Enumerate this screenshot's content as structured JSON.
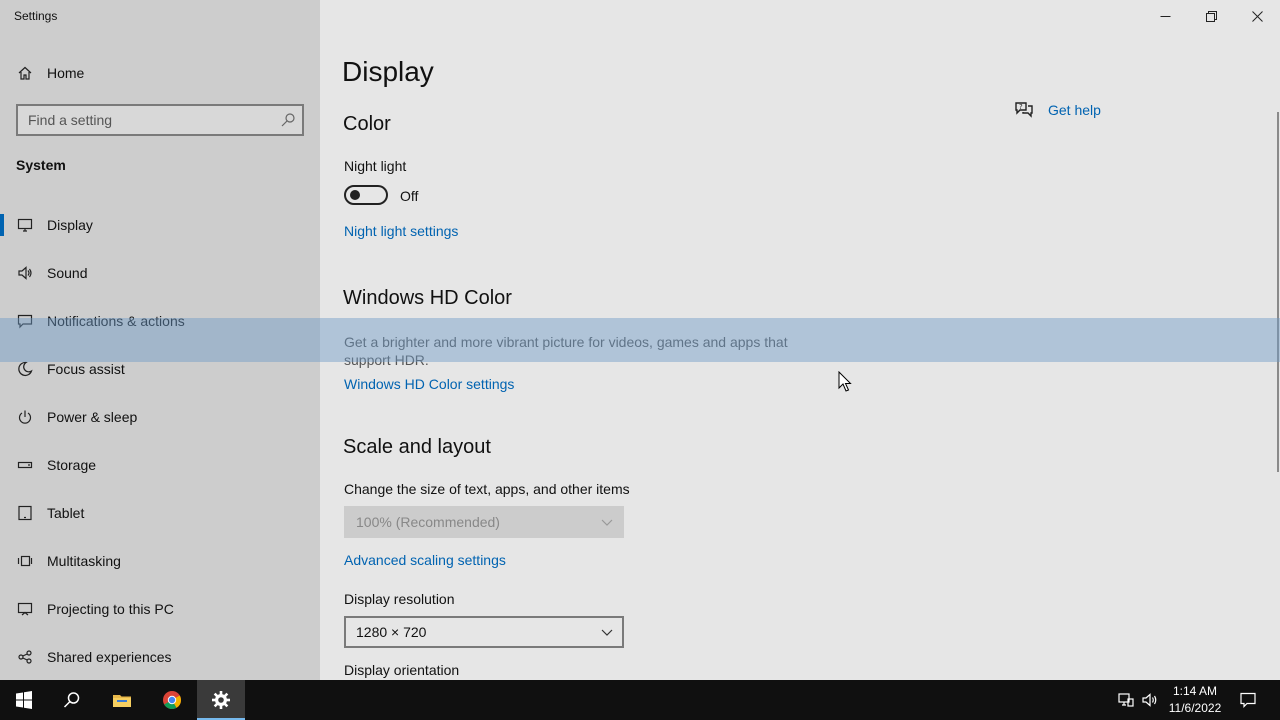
{
  "window": {
    "app_title": "Settings",
    "controls": [
      "minimize",
      "restore",
      "close"
    ]
  },
  "sidebar": {
    "home_label": "Home",
    "search_placeholder": "Find a setting",
    "section_title": "System",
    "items": [
      {
        "label": "Display",
        "icon": "monitor-icon",
        "active": true
      },
      {
        "label": "Sound",
        "icon": "speaker-icon",
        "active": false
      },
      {
        "label": "Notifications & actions",
        "icon": "message-icon",
        "active": false
      },
      {
        "label": "Focus assist",
        "icon": "moon-icon",
        "active": false
      },
      {
        "label": "Power & sleep",
        "icon": "power-icon",
        "active": false
      },
      {
        "label": "Storage",
        "icon": "storage-icon",
        "active": false
      },
      {
        "label": "Tablet",
        "icon": "tablet-icon",
        "active": false
      },
      {
        "label": "Multitasking",
        "icon": "multitasking-icon",
        "active": false
      },
      {
        "label": "Projecting to this PC",
        "icon": "projecting-icon",
        "active": false
      },
      {
        "label": "Shared experiences",
        "icon": "shared-icon",
        "active": false
      }
    ]
  },
  "main": {
    "page_title": "Display",
    "help_link": "Get help",
    "color": {
      "heading": "Color",
      "night_light_label": "Night light",
      "night_light_state": "Off",
      "night_light_link": "Night light settings"
    },
    "hd_color": {
      "heading": "Windows HD Color",
      "description": "Get a brighter and more vibrant picture for videos, games and apps that support HDR.",
      "link": "Windows HD Color settings"
    },
    "scale": {
      "heading": "Scale and layout",
      "size_label": "Change the size of text, apps, and other items",
      "size_value": "100% (Recommended)",
      "advanced_link": "Advanced scaling settings",
      "resolution_label": "Display resolution",
      "resolution_value": "1280 × 720",
      "orientation_label": "Display orientation"
    }
  },
  "taskbar": {
    "apps": [
      "start-icon",
      "search-icon",
      "file-explorer-icon",
      "chrome-icon",
      "settings-icon"
    ],
    "time": "1:14 AM",
    "date": "11/6/2022"
  },
  "colors": {
    "accent": "#0063b1",
    "sidebar_bg": "#cdcdcd",
    "main_bg": "#e6e6e6",
    "taskbar_bg": "#101010"
  }
}
